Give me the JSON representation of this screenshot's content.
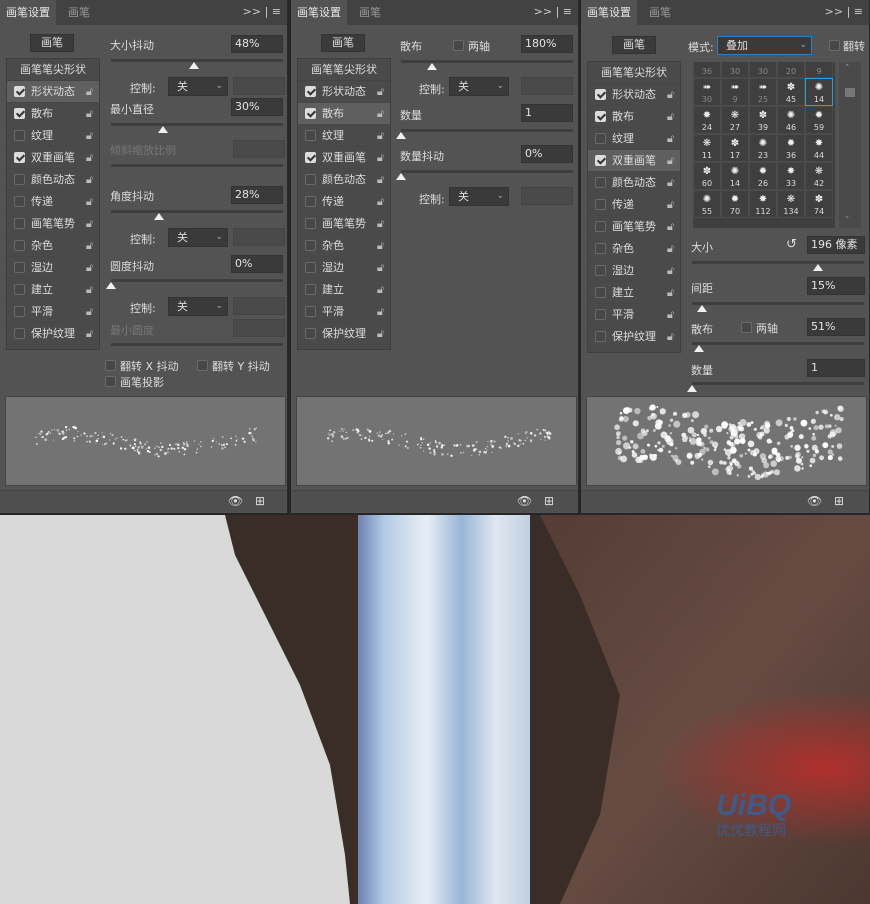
{
  "tabs": {
    "settings": "画笔设置",
    "brush": "画笔"
  },
  "menu": {
    "expand": ">>",
    "menu_icon": "≡"
  },
  "brush_button": "画笔",
  "tip_shape": "画笔笔尖形状",
  "lock_icon": "lock-icon",
  "control_label": "控制:",
  "control_value": "关",
  "panels": [
    {
      "selected": 0,
      "items": [
        {
          "label": "形状动态",
          "checked": true
        },
        {
          "label": "散布",
          "checked": true
        },
        {
          "label": "纹理",
          "checked": false
        },
        {
          "label": "双重画笔",
          "checked": true
        },
        {
          "label": "颜色动态",
          "checked": false
        },
        {
          "label": "传递",
          "checked": false
        },
        {
          "label": "画笔笔势",
          "checked": false
        },
        {
          "label": "杂色",
          "checked": false
        },
        {
          "label": "湿边",
          "checked": false
        },
        {
          "label": "建立",
          "checked": false
        },
        {
          "label": "平滑",
          "checked": false
        },
        {
          "label": "保护纹理",
          "checked": false
        }
      ]
    },
    {
      "selected": 1,
      "items": [
        {
          "label": "形状动态",
          "checked": true
        },
        {
          "label": "散布",
          "checked": true
        },
        {
          "label": "纹理",
          "checked": false
        },
        {
          "label": "双重画笔",
          "checked": true
        },
        {
          "label": "颜色动态",
          "checked": false
        },
        {
          "label": "传递",
          "checked": false
        },
        {
          "label": "画笔笔势",
          "checked": false
        },
        {
          "label": "杂色",
          "checked": false
        },
        {
          "label": "湿边",
          "checked": false
        },
        {
          "label": "建立",
          "checked": false
        },
        {
          "label": "平滑",
          "checked": false
        },
        {
          "label": "保护纹理",
          "checked": false
        }
      ]
    },
    {
      "selected": 3,
      "items": [
        {
          "label": "形状动态",
          "checked": true
        },
        {
          "label": "散布",
          "checked": true
        },
        {
          "label": "纹理",
          "checked": false
        },
        {
          "label": "双重画笔",
          "checked": true
        },
        {
          "label": "颜色动态",
          "checked": false
        },
        {
          "label": "传递",
          "checked": false
        },
        {
          "label": "画笔笔势",
          "checked": false
        },
        {
          "label": "杂色",
          "checked": false
        },
        {
          "label": "湿边",
          "checked": false
        },
        {
          "label": "建立",
          "checked": false
        },
        {
          "label": "平滑",
          "checked": false
        },
        {
          "label": "保护纹理",
          "checked": false
        }
      ]
    }
  ],
  "shape_dynamics": {
    "size_jitter": {
      "label": "大小抖动",
      "value": "48%",
      "fraction": 0.48
    },
    "min_diameter": {
      "label": "最小直径",
      "value": "30%",
      "fraction": 0.3
    },
    "tilt_scale": {
      "label": "倾斜缩放比例"
    },
    "angle_jitter": {
      "label": "角度抖动",
      "value": "28%",
      "fraction": 0.28
    },
    "roundness_jitter": {
      "label": "圆度抖动",
      "value": "0%",
      "fraction": 0
    },
    "min_roundness": {
      "label": "最小圆度"
    },
    "flip_x": "翻转 X 抖动",
    "flip_y": "翻转 Y 抖动",
    "projection": "画笔投影"
  },
  "scattering": {
    "scatter": {
      "label": "散布",
      "value": "180%",
      "fraction": 0.18
    },
    "both_axes": "两轴",
    "count": {
      "label": "数量",
      "value": "1",
      "fraction": 0
    },
    "count_jitter": {
      "label": "数量抖动",
      "value": "0%",
      "fraction": 0
    }
  },
  "dual_brush": {
    "mode_label": "模式:",
    "mode_value": "叠加",
    "flip": "翻转",
    "brush_sizes": [
      [
        "36",
        "30",
        "30",
        "20",
        "9"
      ],
      [
        "30",
        "9",
        "25",
        "45",
        "14"
      ],
      [
        "24",
        "27",
        "39",
        "46",
        "59"
      ],
      [
        "11",
        "17",
        "23",
        "36",
        "44"
      ],
      [
        "60",
        "14",
        "26",
        "33",
        "42"
      ],
      [
        "55",
        "70",
        "112",
        "134",
        "74"
      ]
    ],
    "selected_brush": "14",
    "size": {
      "label": "大小",
      "value": "196 像素",
      "fraction": 0.73
    },
    "spacing": {
      "label": "间距",
      "value": "15%",
      "fraction": 0.06
    },
    "scatter": {
      "label": "散布",
      "value": "51%",
      "fraction": 0.04
    },
    "both_axes": "两轴",
    "count": {
      "label": "数量",
      "value": "1",
      "fraction": 0
    }
  },
  "watermark": {
    "logo": "UiBQ",
    "text": "优优教程网"
  }
}
